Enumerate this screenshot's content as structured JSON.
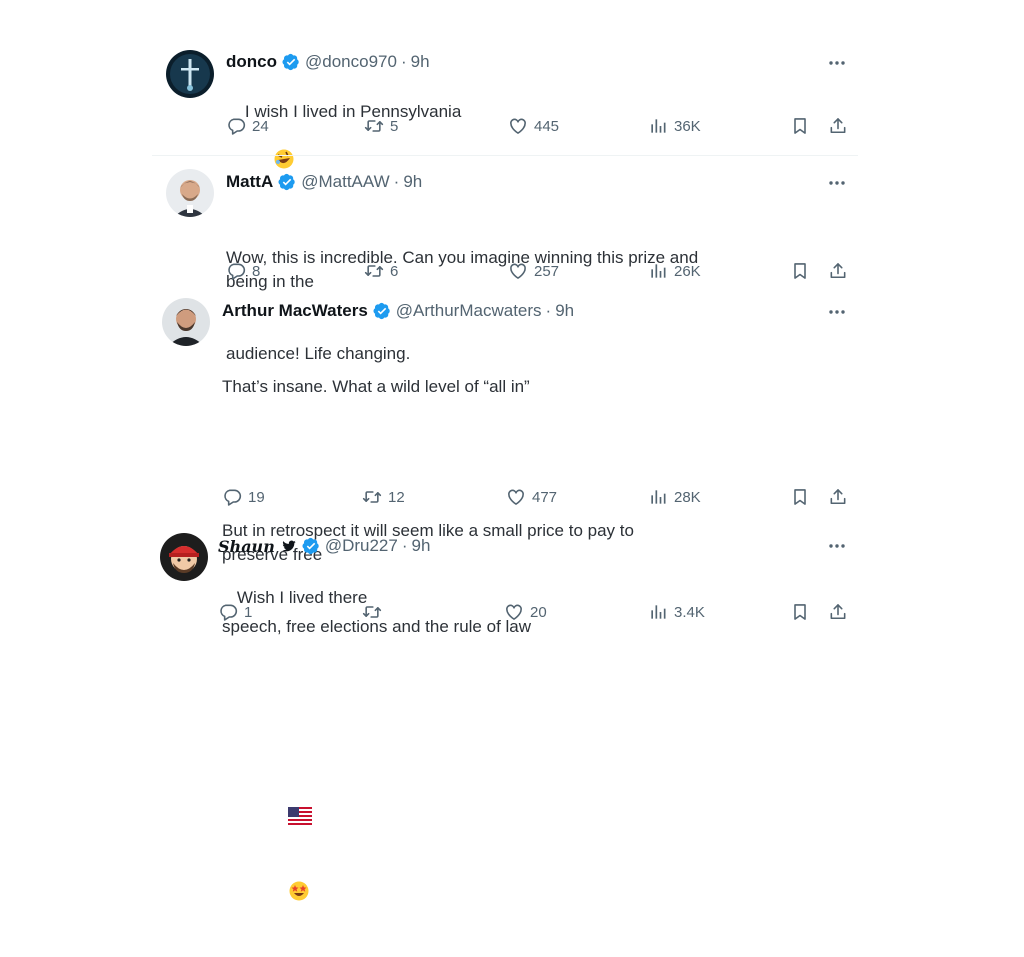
{
  "tweets": [
    {
      "name": "donco",
      "handle": "@donco970",
      "sep": "·",
      "time": "9h",
      "text": "I wish I lived in Pennsylvania",
      "text_emoji": "rofl-emoji",
      "replies": "24",
      "retweets": "5",
      "likes": "445",
      "views": "36K"
    },
    {
      "name": "MattA",
      "handle": "@MattAAW",
      "sep": "·",
      "time": "9h",
      "text_line1": "Wow, this is incredible. Can you imagine winning this prize and being in the",
      "text_line2": "audience! Life changing.",
      "replies": "8",
      "retweets": "6",
      "likes": "257",
      "views": "26K"
    },
    {
      "name": "Arthur MacWaters",
      "handle": "@ArthurMacwaters",
      "sep": "·",
      "time": "9h",
      "text_line1": "That’s insane. What a wild level of “all in”",
      "text_line2": "But in retrospect it will seem like a small price to pay to preserve free",
      "text_line3": "speech, free elections and the rule of law",
      "text_emojis": [
        "us-flag-emoji",
        "star-struck-emoji"
      ],
      "replies": "19",
      "retweets": "12",
      "likes": "477",
      "views": "28K"
    },
    {
      "name": "Shaun",
      "handle": "@Dru227",
      "sep": "·",
      "time": "9h",
      "text": "Wish I lived there",
      "replies": "1",
      "retweets": "",
      "likes": "20",
      "views": "3.4K"
    }
  ],
  "icons": {
    "verified_color": "#1d9bf0",
    "action_color": "#536471",
    "reply": "reply-icon",
    "retweet": "retweet-icon",
    "like": "heart-icon",
    "views": "views-icon",
    "bookmark": "bookmark-icon",
    "share": "share-icon",
    "more": "more-icon"
  }
}
